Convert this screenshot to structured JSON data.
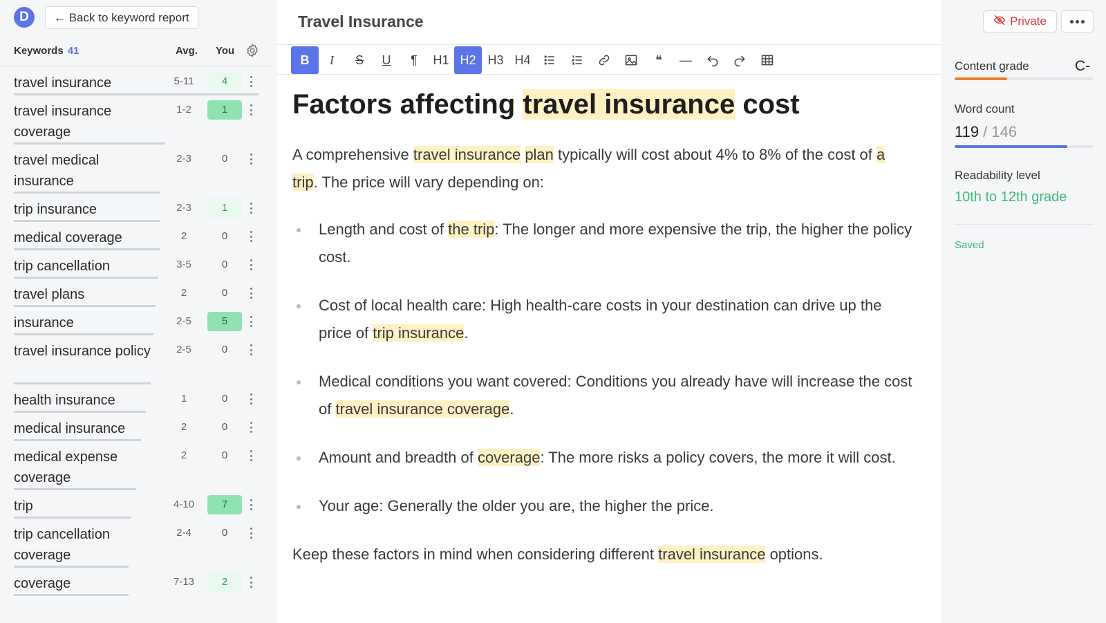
{
  "sidebar": {
    "logo_letter": "D",
    "back_label": "← Back to keyword report",
    "keywords_title": "Keywords",
    "keywords_count": "41",
    "col_avg": "Avg.",
    "col_you": "You",
    "keywords": [
      {
        "name": "travel insurance",
        "avg": "5-11",
        "you": "4",
        "style": "low",
        "coverage": 1.0
      },
      {
        "name": "travel insurance coverage",
        "avg": "1-2",
        "you": "1",
        "style": "hit",
        "coverage": 0.62
      },
      {
        "name": "travel medical insurance",
        "avg": "2-3",
        "you": "0",
        "style": "",
        "coverage": 0.6
      },
      {
        "name": "trip insurance",
        "avg": "2-3",
        "you": "1",
        "style": "low",
        "coverage": 0.6
      },
      {
        "name": "medical coverage",
        "avg": "2",
        "you": "0",
        "style": "",
        "coverage": 0.6
      },
      {
        "name": "trip cancellation",
        "avg": "3-5",
        "you": "0",
        "style": "",
        "coverage": 0.59
      },
      {
        "name": "travel plans",
        "avg": "2",
        "you": "0",
        "style": "",
        "coverage": 0.58
      },
      {
        "name": "insurance",
        "avg": "2-5",
        "you": "5",
        "style": "hit",
        "coverage": 0.57
      },
      {
        "name": "travel insurance policy",
        "avg": "2-5",
        "you": "0",
        "style": "",
        "coverage": 0.56
      },
      {
        "name": "health insurance",
        "avg": "1",
        "you": "0",
        "style": "",
        "coverage": 0.54
      },
      {
        "name": "medical insurance",
        "avg": "2",
        "you": "0",
        "style": "",
        "coverage": 0.52
      },
      {
        "name": "medical expense coverage",
        "avg": "2",
        "you": "0",
        "style": "",
        "coverage": 0.5
      },
      {
        "name": "trip",
        "avg": "4-10",
        "you": "7",
        "style": "hit",
        "coverage": 0.48
      },
      {
        "name": "trip cancellation coverage",
        "avg": "2-4",
        "you": "0",
        "style": "",
        "coverage": 0.47
      },
      {
        "name": "coverage",
        "avg": "7-13",
        "you": "2",
        "style": "low",
        "coverage": 0.47
      }
    ]
  },
  "editor": {
    "doc_title": "Travel Insurance",
    "toolbar": [
      {
        "id": "bold",
        "label": "B",
        "active": true
      },
      {
        "id": "italic",
        "label": "I",
        "active": false
      },
      {
        "id": "strike",
        "label": "S",
        "active": false
      },
      {
        "id": "underline",
        "label": "U",
        "active": false
      },
      {
        "id": "paragraph",
        "label": "¶",
        "active": false
      },
      {
        "id": "h1",
        "label": "H1",
        "active": false
      },
      {
        "id": "h2",
        "label": "H2",
        "active": true
      },
      {
        "id": "h3",
        "label": "H3",
        "active": false
      },
      {
        "id": "h4",
        "label": "H4",
        "active": false
      },
      {
        "id": "bullet-list",
        "label": "",
        "active": false
      },
      {
        "id": "ordered-list",
        "label": "",
        "active": false
      },
      {
        "id": "link",
        "label": "",
        "active": false
      },
      {
        "id": "image",
        "label": "",
        "active": false
      },
      {
        "id": "quote",
        "label": "❝",
        "active": false
      },
      {
        "id": "hr",
        "label": "—",
        "active": false
      },
      {
        "id": "undo",
        "label": "",
        "active": false
      },
      {
        "id": "redo",
        "label": "",
        "active": false
      },
      {
        "id": "table",
        "label": "",
        "active": false
      }
    ],
    "heading": [
      {
        "t": "Factors affecting ",
        "h": false
      },
      {
        "t": "travel insurance",
        "h": true
      },
      {
        "t": " cost",
        "h": false
      }
    ],
    "intro": [
      {
        "t": "A comprehensive ",
        "h": false
      },
      {
        "t": "travel insurance",
        "h": true
      },
      {
        "t": " ",
        "h": false
      },
      {
        "t": "plan",
        "h": true
      },
      {
        "t": " typically will cost about 4% to 8% of the cost of ",
        "h": false
      },
      {
        "t": "a trip",
        "h": true
      },
      {
        "t": ". The price will vary depending on:",
        "h": false
      }
    ],
    "bullets": [
      [
        {
          "t": "Length and cost of ",
          "h": false
        },
        {
          "t": "the trip",
          "h": true
        },
        {
          "t": ": The longer and more expensive the trip, the higher the policy cost.",
          "h": false
        }
      ],
      [
        {
          "t": "Cost of local health care: High health-care costs in your destination can drive up the price of ",
          "h": false
        },
        {
          "t": "trip insurance",
          "h": true
        },
        {
          "t": ".",
          "h": false
        }
      ],
      [
        {
          "t": "Medical conditions you want covered: Conditions you already have will increase the cost of ",
          "h": false
        },
        {
          "t": "travel insurance coverage",
          "h": true
        },
        {
          "t": ".",
          "h": false
        }
      ],
      [
        {
          "t": "Amount and breadth of ",
          "h": false
        },
        {
          "t": "coverage",
          "h": true
        },
        {
          "t": ": The more risks a policy covers, the more it will cost.",
          "h": false
        }
      ],
      [
        {
          "t": "Your age: Generally the older you are, the higher the price.",
          "h": false
        }
      ]
    ],
    "closing": [
      {
        "t": "Keep these factors in mind when considering different ",
        "h": false
      },
      {
        "t": "travel insurance",
        "h": true
      },
      {
        "t": " options.",
        "h": false
      }
    ]
  },
  "panel": {
    "private_label": "Private",
    "content_grade_label": "Content grade",
    "content_grade": "C-",
    "content_grade_progress": 0.38,
    "word_count_label": "Word count",
    "word_count": "119",
    "word_count_target": "/ 146",
    "word_count_progress": 0.815,
    "readability_label": "Readability level",
    "readability_value": "10th to 12th grade",
    "saved_label": "Saved"
  },
  "colors": {
    "accent": "#5b74e8",
    "highlight": "#fdf1c3",
    "hit": "#8fe3b1",
    "grade_bar": "#f07d2a",
    "success": "#3cba7a",
    "danger": "#d9363e"
  }
}
